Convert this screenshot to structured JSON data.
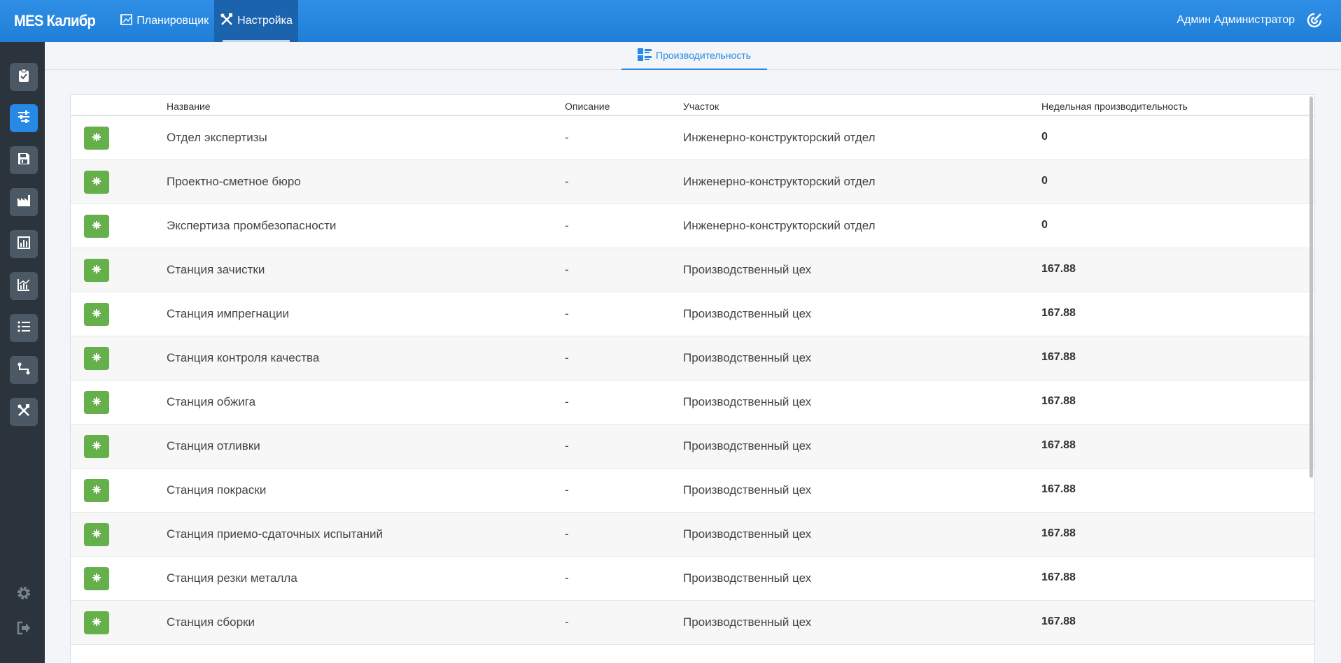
{
  "header": {
    "brand": "MES Калибр",
    "nav": [
      {
        "label": "Планировщик",
        "icon": "planner-icon"
      },
      {
        "label": "Настройка",
        "icon": "tools-icon",
        "active": true
      }
    ],
    "user": "Админ Администратор",
    "user_icon": "logout-swirl-icon"
  },
  "sidebar": {
    "items": [
      {
        "icon": "clipboard-check-icon"
      },
      {
        "icon": "sliders-icon",
        "active": true
      },
      {
        "icon": "save-icon"
      },
      {
        "icon": "factory-icon"
      },
      {
        "icon": "bar-chart-icon"
      },
      {
        "icon": "line-chart-icon"
      },
      {
        "icon": "list-icon"
      },
      {
        "icon": "route-icon"
      },
      {
        "icon": "tools-icon"
      }
    ],
    "bottom": [
      {
        "icon": "gear-icon"
      },
      {
        "icon": "sign-out-icon"
      }
    ]
  },
  "subtab": {
    "label": "Производительность",
    "icon": "performance-icon"
  },
  "table": {
    "columns": [
      "Название",
      "Описание",
      "Участок",
      "Недельная производительность"
    ],
    "rows": [
      {
        "name": "Отдел экспертизы",
        "description": "-",
        "area": "Инженерно-конструкторский отдел",
        "weekly": "0"
      },
      {
        "name": "Проектно-сметное бюро",
        "description": "-",
        "area": "Инженерно-конструкторский отдел",
        "weekly": "0"
      },
      {
        "name": "Экспертиза промбезопасности",
        "description": "-",
        "area": "Инженерно-конструкторский отдел",
        "weekly": "0"
      },
      {
        "name": "Станция зачистки",
        "description": "-",
        "area": "Производственный цех",
        "weekly": "167.88"
      },
      {
        "name": "Станция импрегнации",
        "description": "-",
        "area": "Производственный цех",
        "weekly": "167.88"
      },
      {
        "name": "Станция контроля качества",
        "description": "-",
        "area": "Производственный цех",
        "weekly": "167.88"
      },
      {
        "name": "Станция обжига",
        "description": "-",
        "area": "Производственный цех",
        "weekly": "167.88"
      },
      {
        "name": "Станция отливки",
        "description": "-",
        "area": "Производственный цех",
        "weekly": "167.88"
      },
      {
        "name": "Станция покраски",
        "description": "-",
        "area": "Производственный цех",
        "weekly": "167.88"
      },
      {
        "name": "Станция приемо-сдаточных испытаний",
        "description": "-",
        "area": "Производственный цех",
        "weekly": "167.88"
      },
      {
        "name": "Станция резки металла",
        "description": "-",
        "area": "Производственный цех",
        "weekly": "167.88"
      },
      {
        "name": "Станция сборки",
        "description": "-",
        "area": "Производственный цех",
        "weekly": "167.88"
      }
    ]
  },
  "colors": {
    "topbar": "#2689e6",
    "sidebar": "#2b343d",
    "badge": "#66b04b",
    "accent": "#2689e6"
  }
}
